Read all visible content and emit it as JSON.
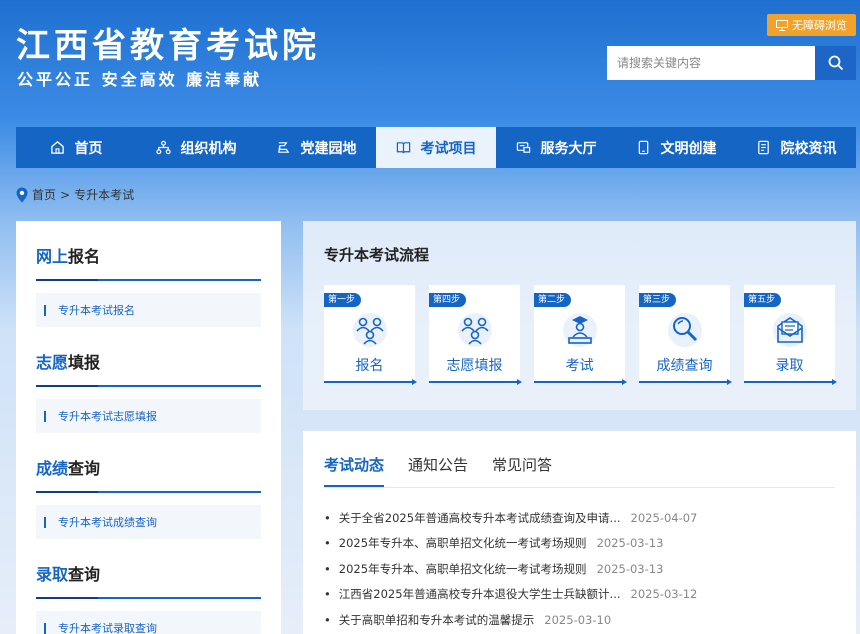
{
  "header": {
    "title": "江西省教育考试院",
    "slogan": "公平公正 安全高效 廉洁奉献",
    "accessibility_label": "无障碍浏览",
    "search_placeholder": "请搜索关键内容"
  },
  "nav": {
    "items": [
      {
        "label": "首页",
        "icon": "home-icon"
      },
      {
        "label": "组织机构",
        "icon": "org-icon"
      },
      {
        "label": "党建园地",
        "icon": "party-icon"
      },
      {
        "label": "考试项目",
        "icon": "book-icon",
        "active": true
      },
      {
        "label": "服务大厅",
        "icon": "service-icon"
      },
      {
        "label": "文明创建",
        "icon": "phone-icon"
      },
      {
        "label": "院校资讯",
        "icon": "doc-icon"
      }
    ]
  },
  "breadcrumb": {
    "home": "首页",
    "separator": ">",
    "current": "专升本考试"
  },
  "sidebar": {
    "sections": [
      {
        "title_hl": "网上",
        "title_rest": "报名",
        "link": "专升本考试报名"
      },
      {
        "title_hl": "志愿",
        "title_rest": "填报",
        "link": "专升本考试志愿填报"
      },
      {
        "title_hl": "成绩",
        "title_rest": "查询",
        "link": "专升本考试成绩查询"
      },
      {
        "title_hl": "录取",
        "title_rest": "查询",
        "link": "专升本考试录取查询"
      }
    ]
  },
  "process": {
    "title": "专升本考试流程",
    "steps": [
      {
        "badge": "第一步",
        "label": "报名",
        "icon": "users-icon"
      },
      {
        "badge": "第四步",
        "label": "志愿填报",
        "icon": "users-icon"
      },
      {
        "badge": "第二步",
        "label": "考试",
        "icon": "exam-icon"
      },
      {
        "badge": "第三步",
        "label": "成绩查询",
        "icon": "magnifier-icon"
      },
      {
        "badge": "第五步",
        "label": "录取",
        "icon": "mail-icon"
      }
    ]
  },
  "news": {
    "tabs": [
      "考试动态",
      "通知公告",
      "常见问答"
    ],
    "items": [
      {
        "title": "关于全省2025年普通高校专升本考试成绩查询及申请...",
        "date": "2025-04-07"
      },
      {
        "title": "2025年专升本、高职单招文化统一考试考场规则",
        "date": "2025-03-13"
      },
      {
        "title": "2025年专升本、高职单招文化统一考试考场规则",
        "date": "2025-03-13"
      },
      {
        "title": "江西省2025年普通高校专升本退役大学生士兵缺额计...",
        "date": "2025-03-12"
      },
      {
        "title": "关于高职单招和专升本考试的温馨提示",
        "date": "2025-03-10"
      }
    ]
  },
  "colors": {
    "primary": "#1565c4",
    "accent_orange": "#f1a22b"
  }
}
